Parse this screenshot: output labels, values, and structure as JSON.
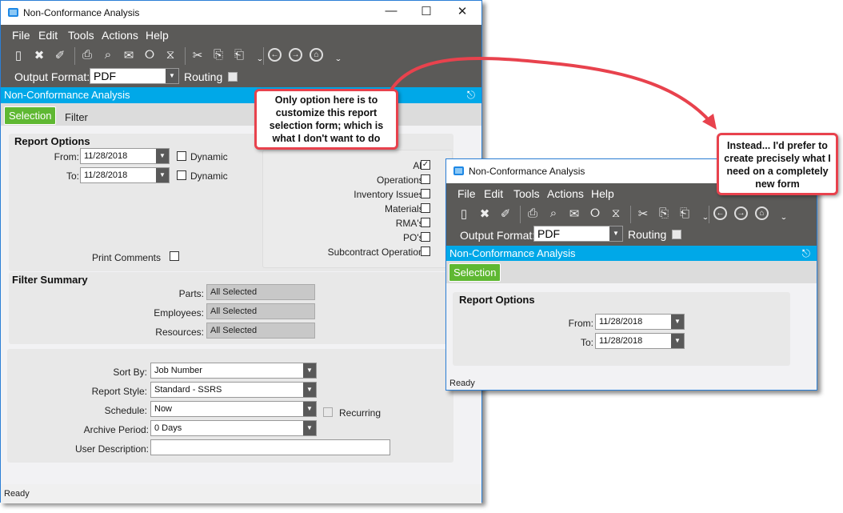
{
  "menu": [
    "File",
    "Edit",
    "Tools",
    "Actions",
    "Help"
  ],
  "toolbar_icons": [
    "new-icon",
    "delete-icon",
    "clear-icon",
    "sep",
    "print-icon",
    "print-preview-icon",
    "email-icon",
    "generate-icon",
    "schedule-icon",
    "sep",
    "cut-icon",
    "copy-icon",
    "paste-icon",
    "more-icon",
    "sep",
    "back-icon",
    "forward-icon",
    "home-icon",
    "more-icon"
  ],
  "main": {
    "title": "Non-Conformance Analysis",
    "output_format_label": "Output Format:",
    "output_format": "PDF",
    "routing_label": "Routing",
    "panel_title": "Non-Conformance Analysis",
    "tabs": [
      "Selection",
      "Filter"
    ],
    "report_options": {
      "heading": "Report Options",
      "from_label": "From:",
      "from": "11/28/2018",
      "to_label": "To:",
      "to": "11/28/2018",
      "dynamic_label": "Dynamic"
    },
    "options": [
      {
        "label": "All:",
        "checked": true
      },
      {
        "label": "Operations:",
        "checked": false
      },
      {
        "label": "Inventory Issues:",
        "checked": false
      },
      {
        "label": "Materials:",
        "checked": false
      },
      {
        "label": "RMA's:",
        "checked": false
      },
      {
        "label": "PO's:",
        "checked": false
      },
      {
        "label": "Subcontract Operation:",
        "checked": false
      }
    ],
    "print_comments_label": "Print Comments",
    "filter_summary": {
      "heading": "Filter Summary",
      "rows": [
        {
          "label": "Parts:",
          "value": "All Selected"
        },
        {
          "label": "Employees:",
          "value": "All Selected"
        },
        {
          "label": "Resources:",
          "value": "All Selected"
        }
      ]
    },
    "settings": {
      "sort_by_label": "Sort By:",
      "sort_by": "Job Number",
      "report_style_label": "Report Style:",
      "report_style": "Standard - SSRS",
      "schedule_label": "Schedule:",
      "schedule": "Now",
      "recurring_label": "Recurring",
      "archive_label": "Archive Period:",
      "archive": "0 Days",
      "user_desc_label": "User Description:",
      "user_desc": ""
    },
    "status": "Ready"
  },
  "second": {
    "title": "Non-Conformance Analysis",
    "output_format_label": "Output Format:",
    "output_format": "PDF",
    "routing_label": "Routing",
    "panel_title": "Non-Conformance Analysis",
    "tab": "Selection",
    "heading": "Report Options",
    "from_label": "From:",
    "from": "11/28/2018",
    "to_label": "To:",
    "to": "11/28/2018",
    "status": "Ready"
  },
  "callouts": {
    "left": "Only option here is to customize this report selection form; which is what I don't want to do",
    "right": "Instead... I'd prefer to create precisely what I need on a completely new form"
  },
  "colors": {
    "accent": "#00a8e8",
    "tab_active": "#5fb832",
    "callout_border": "#e8424d",
    "toolbar": "#5b5a58"
  }
}
